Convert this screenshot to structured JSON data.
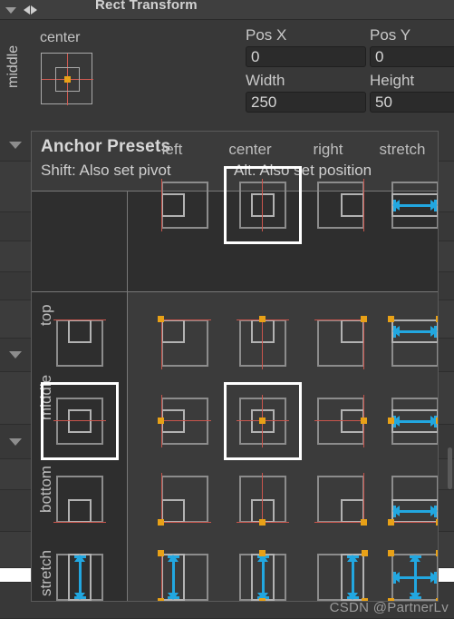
{
  "component": {
    "title": "Rect Transform",
    "foldout_icon": "chevron-down-icon",
    "transform_icon": "rect-transform-icon"
  },
  "anchor_widget": {
    "top_label": "center",
    "left_label": "middle"
  },
  "fields": [
    {
      "label": "Pos X",
      "value": "0"
    },
    {
      "label": "Pos Y",
      "value": "0"
    },
    {
      "label": "Width",
      "value": "250"
    },
    {
      "label": "Height",
      "value": "50"
    }
  ],
  "popup": {
    "title": "Anchor Presets",
    "hint_shift": "Shift: Also set pivot",
    "hint_alt": "Alt: Also set position",
    "columns": [
      "left",
      "center",
      "right",
      "stretch"
    ],
    "rows": [
      "top",
      "middle",
      "bottom",
      "stretch"
    ],
    "selected_column": "center",
    "selected_row": "middle",
    "selected_cell": "middle-center"
  },
  "colors": {
    "panel_bg": "#383838",
    "popup_bg": "#3b3b3b",
    "header_bg": "#2e2e2e",
    "divider": "#787878",
    "anchor_line": "#c9554c",
    "pivot": "#e8a117",
    "stretch_arrow": "#22a7e0",
    "selection": "#ffffff",
    "text": "#cfcfcf"
  },
  "watermark": "CSDN @PartnerLv"
}
